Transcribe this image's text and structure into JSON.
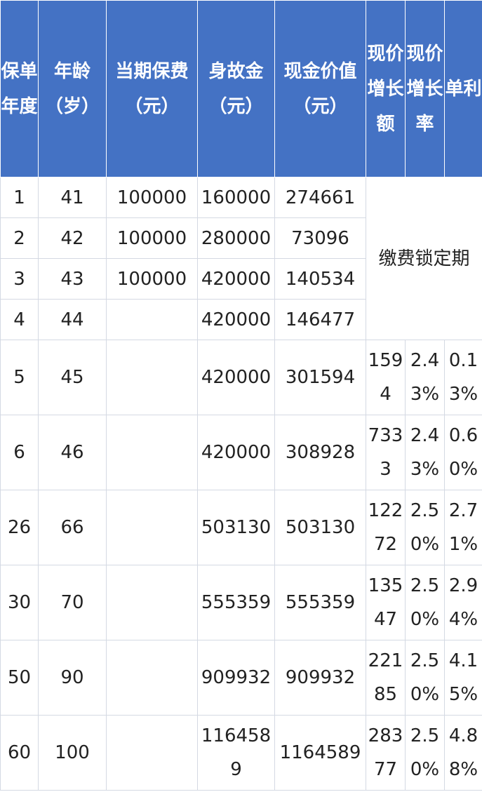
{
  "headers": {
    "policy_year": "保单年度",
    "age": "年龄（岁）",
    "premium": "当期保费（元）",
    "death_benefit": "身故金（元）",
    "cash_value": "现金价值（元）",
    "cv_increase": "现价增长额",
    "cv_growth_rate": "现价增长率",
    "simple_interest": "单利"
  },
  "locked_period_label": "缴费锁定期",
  "rows": [
    {
      "year": "1",
      "age": "41",
      "premium": "100000",
      "death": "160000",
      "cash": "274661"
    },
    {
      "year": "2",
      "age": "42",
      "premium": "100000",
      "death": "280000",
      "cash": "73096"
    },
    {
      "year": "3",
      "age": "43",
      "premium": "100000",
      "death": "420000",
      "cash": "140534"
    },
    {
      "year": "4",
      "age": "44",
      "premium": "",
      "death": "420000",
      "cash": "146477"
    },
    {
      "year": "5",
      "age": "45",
      "premium": "",
      "death": "420000",
      "cash": "301594",
      "increase": "1594",
      "rate": "2.43%",
      "simple": "0.13%"
    },
    {
      "year": "6",
      "age": "46",
      "premium": "",
      "death": "420000",
      "cash": "308928",
      "increase": "7333",
      "rate": "2.43%",
      "simple": "0.60%"
    },
    {
      "year": "26",
      "age": "66",
      "premium": "",
      "death": "503130",
      "cash": "503130",
      "increase": "12272",
      "rate": "2.50%",
      "simple": "2.71%"
    },
    {
      "year": "30",
      "age": "70",
      "premium": "",
      "death": "555359",
      "cash": "555359",
      "increase": "13547",
      "rate": "2.50%",
      "simple": "2.94%"
    },
    {
      "year": "50",
      "age": "90",
      "premium": "",
      "death": "909932",
      "cash": "909932",
      "increase": "22185",
      "rate": "2.50%",
      "simple": "4.15%"
    },
    {
      "year": "60",
      "age": "100",
      "premium": "",
      "death": "1164589",
      "cash": "1164589",
      "increase": "28377",
      "rate": "2.50%",
      "simple": "4.88%"
    }
  ]
}
